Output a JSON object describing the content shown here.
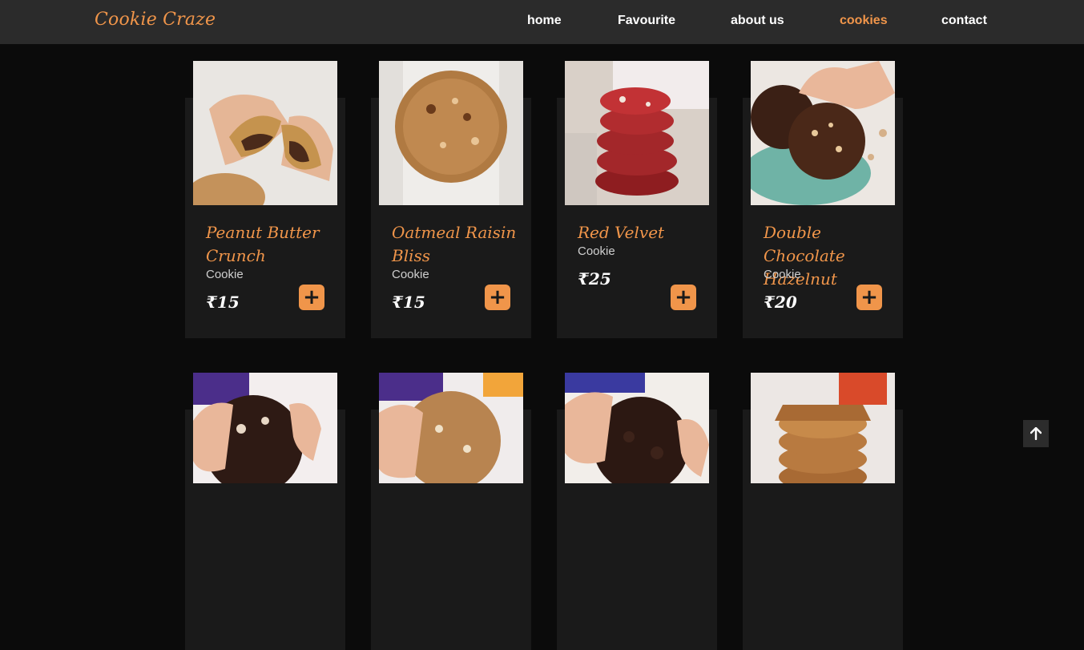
{
  "brand": "Cookie Craze",
  "nav": {
    "home": "home",
    "favourite": "Favourite",
    "about": "about us",
    "cookies": "cookies",
    "contact": "contact"
  },
  "cards": [
    {
      "title": "Peanut Butter Crunch",
      "subtitle": "Cookie",
      "price": "₹15"
    },
    {
      "title": "Oatmeal Raisin Bliss",
      "subtitle": "Cookie",
      "price": "₹15"
    },
    {
      "title": "Red Velvet",
      "subtitle": "Cookie",
      "price": "₹25"
    },
    {
      "title": "Double Chocolate Hazelnut",
      "subtitle": "Cookie",
      "price": "₹20"
    }
  ],
  "add_label": "+",
  "colors": {
    "accent": "#f0954a",
    "card_bg": "#1a1a1a",
    "nav_bg": "#2b2b2b",
    "page_bg": "#0b0b0b"
  }
}
